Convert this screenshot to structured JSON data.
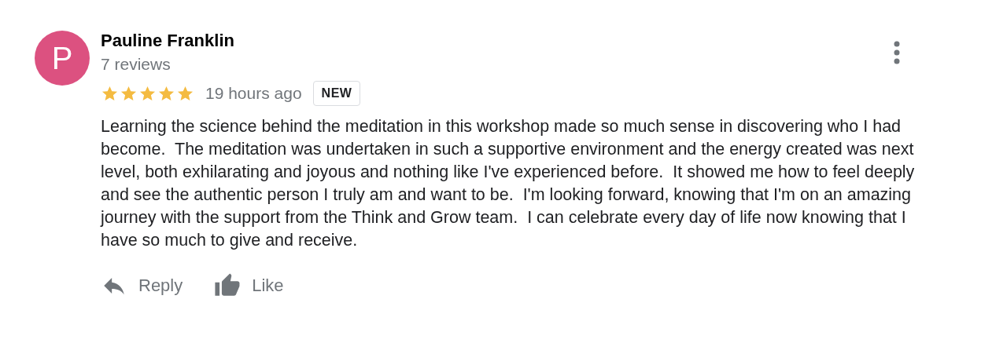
{
  "review": {
    "avatar_letter": "P",
    "author": "Pauline Franklin",
    "review_count": "7 reviews",
    "stars": 5,
    "time": "19 hours ago",
    "badge": "NEW",
    "text": "Learning the science behind the meditation in this workshop made so much sense in discovering who I had become.  The meditation was undertaken in such a supportive environment and the energy created was next level, both exhilarating and joyous and nothing like I've experienced before.  It showed me how to feel deeply and see the authentic person I truly am and want to be.  I'm looking forward, knowing that I'm on an amazing journey with the support from the Think and Grow team.  I can celebrate every day of life now knowing that I have so much to give and receive.",
    "actions": [
      {
        "kind": "reply",
        "label": "Reply"
      },
      {
        "kind": "like",
        "label": "Like"
      }
    ]
  }
}
